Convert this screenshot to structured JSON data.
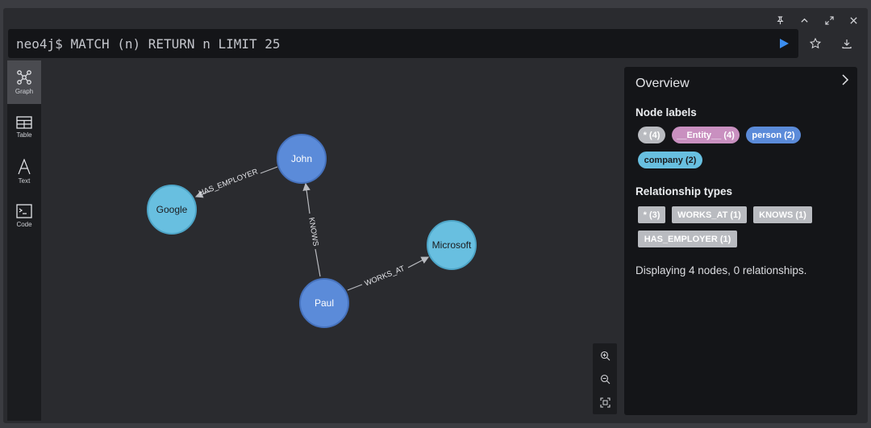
{
  "editor": {
    "prompt": "neo4j$",
    "query": "MATCH (n) RETURN n LIMIT 25"
  },
  "window_controls": [
    "pin-icon",
    "collapse-icon",
    "expand-icon",
    "close-icon"
  ],
  "sidebar": {
    "items": [
      {
        "label": "Graph",
        "icon": "graph-icon",
        "active": true
      },
      {
        "label": "Table",
        "icon": "table-icon",
        "active": false
      },
      {
        "label": "Text",
        "icon": "text-icon",
        "active": false
      },
      {
        "label": "Code",
        "icon": "code-icon",
        "active": false
      }
    ]
  },
  "graph": {
    "nodes": [
      {
        "id": "john",
        "label": "John",
        "type": "person",
        "color": "#5b8bd9"
      },
      {
        "id": "google",
        "label": "Google",
        "type": "company",
        "color": "#68bfe0"
      },
      {
        "id": "microsoft",
        "label": "Microsoft",
        "type": "company",
        "color": "#68bfe0"
      },
      {
        "id": "paul",
        "label": "Paul",
        "type": "person",
        "color": "#5b8bd9"
      }
    ],
    "edges": [
      {
        "from": "john",
        "to": "google",
        "label": "HAS_EMPLOYER"
      },
      {
        "from": "paul",
        "to": "john",
        "label": "KNOWS"
      },
      {
        "from": "paul",
        "to": "microsoft",
        "label": "WORKS_AT"
      }
    ]
  },
  "overview": {
    "title": "Overview",
    "node_labels_heading": "Node labels",
    "node_labels": [
      {
        "text": "* (4)",
        "bg": "#b9bbc0",
        "fg": "#ffffff"
      },
      {
        "text": "__Entity__ (4)",
        "bg": "#c990c0",
        "fg": "#ffffff"
      },
      {
        "text": "person (2)",
        "bg": "#5b8bd9",
        "fg": "#ffffff"
      },
      {
        "text": "company (2)",
        "bg": "#68bfe0",
        "fg": "#1b1c1f"
      }
    ],
    "relationship_types_heading": "Relationship types",
    "relationship_types": [
      "* (3)",
      "WORKS_AT (1)",
      "KNOWS (1)",
      "HAS_EMPLOYER (1)"
    ],
    "summary": "Displaying 4 nodes, 0 relationships."
  }
}
